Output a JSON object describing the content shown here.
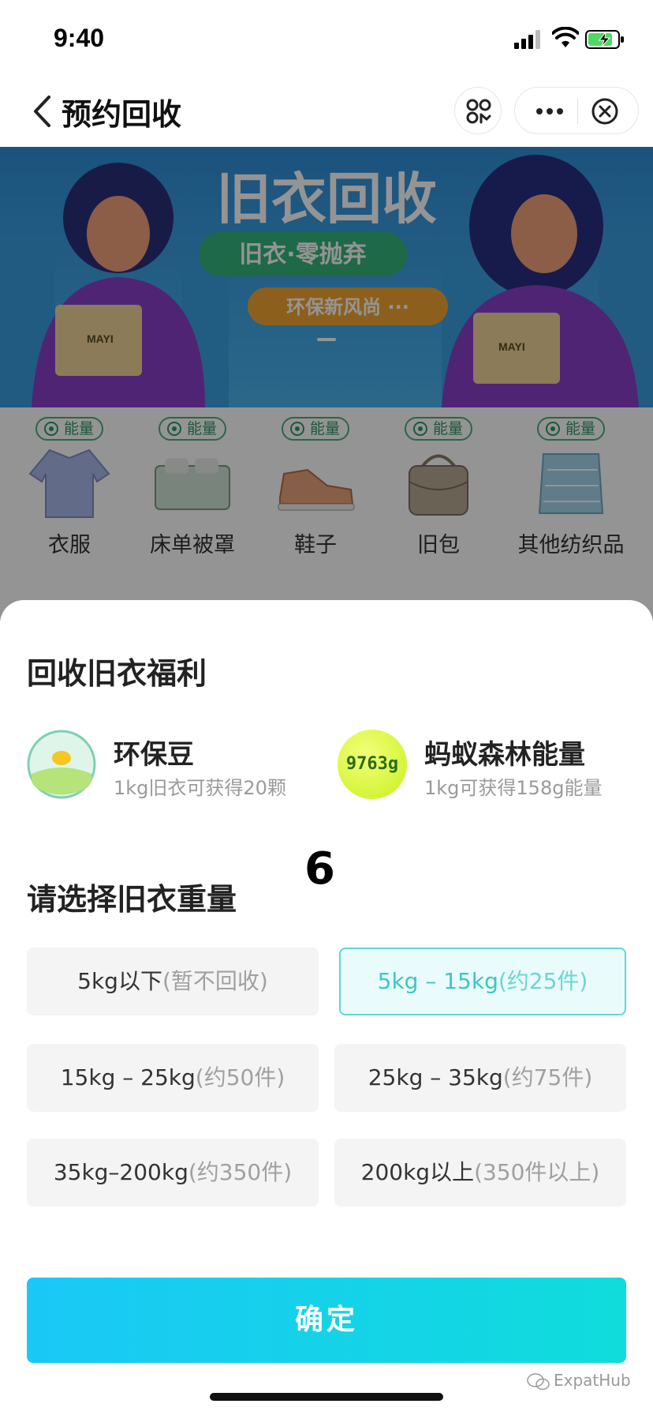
{
  "status_bar": {
    "time": "9:40"
  },
  "nav": {
    "title": "预约回收"
  },
  "banner": {
    "headline": "旧衣回收",
    "pill_1": "旧衣·零抛弃",
    "pill_2": "环保新风尚 ···",
    "box_logo": "MAYI"
  },
  "categories": [
    {
      "badge": "能量",
      "label": "衣服"
    },
    {
      "badge": "能量",
      "label": "床单被罩"
    },
    {
      "badge": "能量",
      "label": "鞋子"
    },
    {
      "badge": "能量",
      "label": "旧包"
    },
    {
      "badge": "能量",
      "label": "其他纺织品"
    }
  ],
  "sheet": {
    "title": "回收旧衣福利",
    "benefits": [
      {
        "name": "环保豆",
        "desc": "1kg旧衣可获得20颗"
      },
      {
        "name": "蚂蚁森林能量",
        "desc": "1kg可获得158g能量",
        "icon_text": "9763g"
      }
    ],
    "weight_title": "请选择旧衣重量",
    "step_number": "6",
    "options": [
      {
        "main": "5kg以下",
        "sub": "(暂不回收)",
        "selected": false
      },
      {
        "main": "5kg – 15kg",
        "sub": "(约25件)",
        "selected": true
      },
      {
        "main": "15kg – 25kg",
        "sub": "(约50件)",
        "selected": false
      },
      {
        "main": "25kg – 35kg",
        "sub": "(约75件)",
        "selected": false
      },
      {
        "main": "35kg–200kg",
        "sub": "(约350件)",
        "selected": false
      },
      {
        "main": "200kg以上",
        "sub": "(350件以上)",
        "selected": false
      }
    ],
    "confirm_label": "确定"
  },
  "watermark": "ExpatHub",
  "colors": {
    "accent_teal": "#3cc8c4",
    "button_gradient_start": "#1ac8f6",
    "button_gradient_end": "#10dcdc",
    "energy_green": "#2e9a64"
  }
}
